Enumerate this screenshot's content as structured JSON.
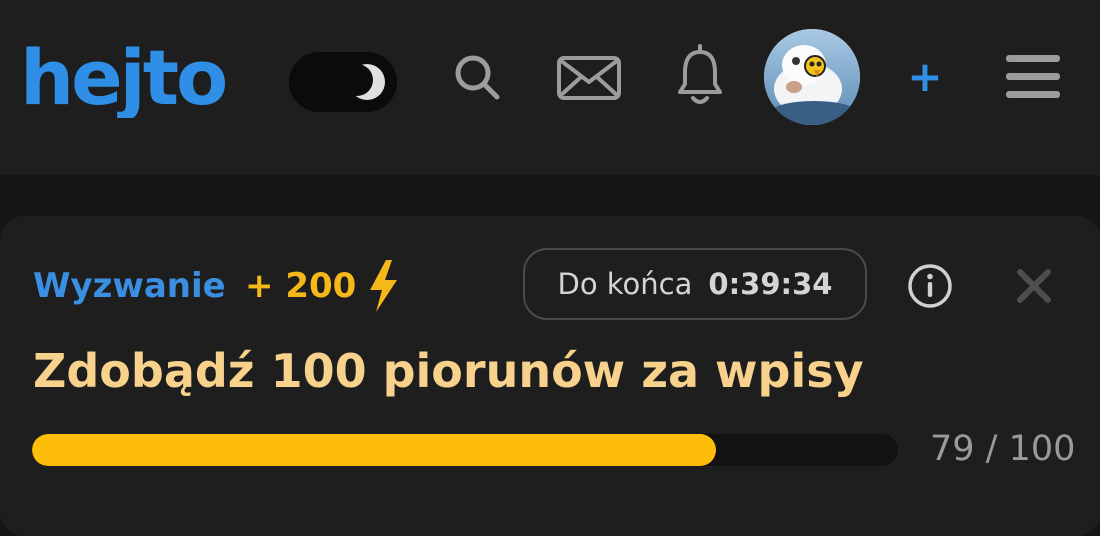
{
  "header": {
    "logo_text": "hejto",
    "brand_color": "#2f8fe6",
    "theme_toggle_icon": "moon-icon",
    "search_icon": "search-icon",
    "messages_icon": "envelope-icon",
    "notifications_icon": "bell-icon",
    "avatar": "user-avatar",
    "add_label": "+",
    "menu_icon": "hamburger-icon"
  },
  "challenge": {
    "label": "Wyzwanie",
    "points": "+ 200",
    "points_icon": "lightning-icon",
    "points_color": "#f5b818",
    "timer_label": "Do końca",
    "timer_value": "0:39:34",
    "info_icon": "info-icon",
    "close_icon": "close-icon",
    "title": "Zdobądź 100 piorunów za wpisy",
    "progress_current": 79,
    "progress_total": 100,
    "progress_text": "79 / 100",
    "progress_color": "#fdbd08"
  }
}
